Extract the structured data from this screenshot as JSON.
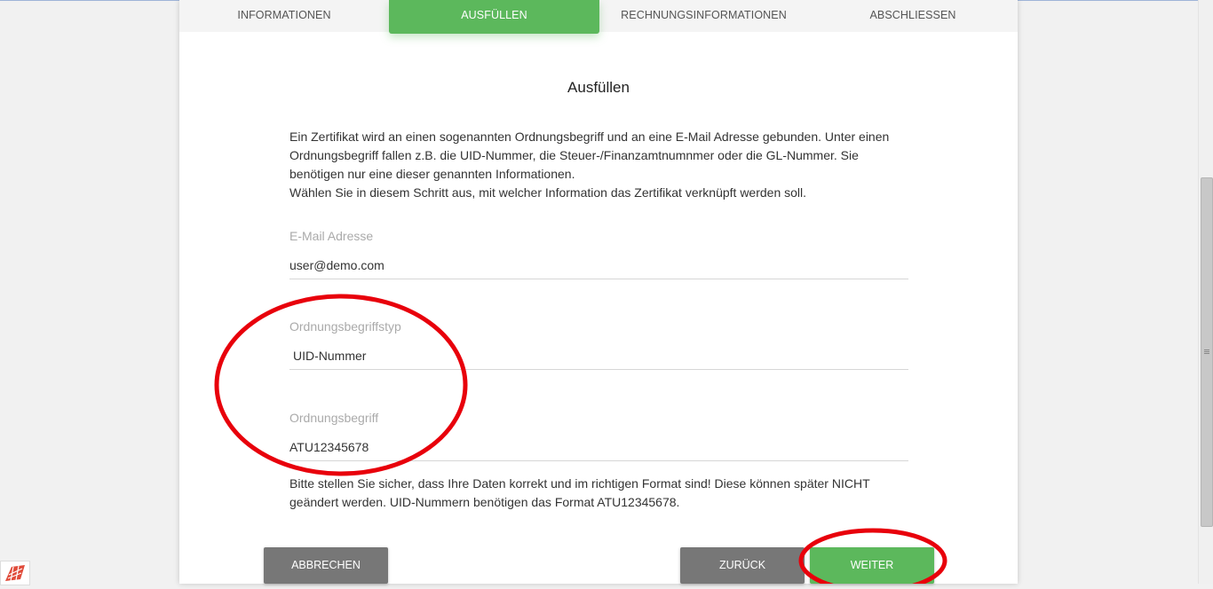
{
  "tabs": [
    {
      "label": "INFORMATIONEN",
      "active": false
    },
    {
      "label": "AUSFÜLLEN",
      "active": true
    },
    {
      "label": "RECHNUNGSINFORMATIONEN",
      "active": false
    },
    {
      "label": "ABSCHLIESSEN",
      "active": false
    }
  ],
  "main": {
    "title": "Ausfüllen",
    "intro_paragraph_1": "Ein Zertifikat wird an einen sogenannten Ordnungsbegriff und an eine E-Mail Adresse gebunden. Unter einen Ordnungsbegriff fallen z.B. die UID-Nummer, die Steuer-/Finanzamtnumnmer oder die GL-Nummer. Sie benötigen nur eine dieser genannten Informationen.",
    "intro_paragraph_2": "Wählen Sie in diesem Schritt aus, mit welcher Information das Zertifikat verknüpft werden soll."
  },
  "form": {
    "email": {
      "label": "E-Mail Adresse",
      "value": "user@demo.com"
    },
    "type": {
      "label": "Ordnungsbegriffstyp",
      "value": "UID-Nummer"
    },
    "term": {
      "label": "Ordnungsbegriff",
      "value": "ATU12345678"
    }
  },
  "note": "Bitte stellen Sie sicher, dass Ihre Daten korrekt und im richtigen Format sind! Diese können später NICHT geändert werden. UID-Nummern benötigen das Format ATU12345678.",
  "buttons": {
    "cancel": "ABBRECHEN",
    "back": "ZURÜCK",
    "next": "WEITER"
  },
  "colors": {
    "accent": "#5cb85c",
    "secondary_button": "#777777",
    "annotation": "#e8000b"
  }
}
